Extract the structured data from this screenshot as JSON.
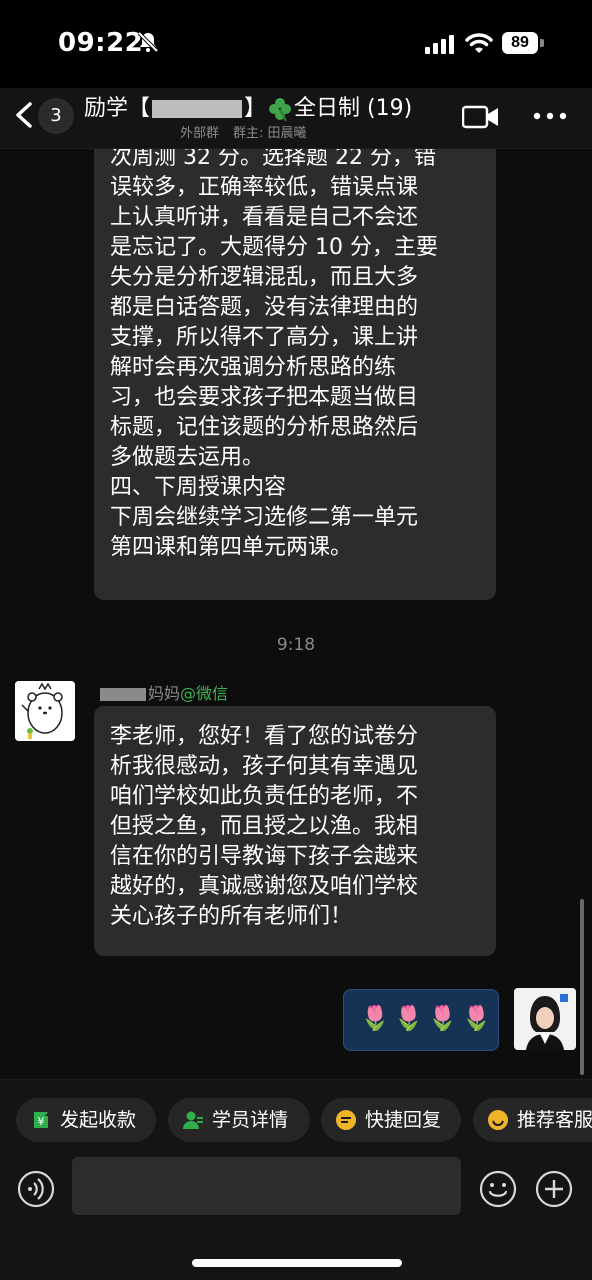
{
  "status_bar": {
    "time": "09:22",
    "battery": "89"
  },
  "header": {
    "unread_count": "3",
    "title_prefix": "励学【",
    "title_suffix": "】",
    "title_rest": "全日制",
    "member_count": "(19)",
    "tag": "外部群",
    "owner": "群主: 田晨曦"
  },
  "messages": {
    "teacher_report": "次周测 32 分。选择题 22 分，错\n误较多，正确率较低，错误点课\n上认真听讲，看看是自己不会还\n是忘记了。大题得分 10 分，主要\n失分是分析逻辑混乱，而且大多\n都是白话答题，没有法律理由的\n支撑，所以得不了高分，课上讲\n解时会再次强调分析思路的练\n习，也会要求孩子把本题当做目\n标题，记住该题的分析思路然后\n多做题去运用。\n四、下周授课内容\n下周会继续学习选修二第一单元\n第四课和第四单元两课。",
    "timestamp": "9:18",
    "sender_suffix": "妈妈",
    "sender_source": "@微信",
    "parent_reply": "李老师，您好！看了您的试卷分\n析我很感动，孩子何其有幸遇见\n咱们学校如此负责任的老师，不\n但授之鱼，而且授之以渔。我相\n信在你的引导教诲下孩子会越来\n越好的，真诚感谢您及咱们学校\n关心孩子的所有老师们！",
    "my_reply": "🌷🌷🌷🌷"
  },
  "quick_actions": [
    "发起收款",
    "学员详情",
    "快捷回复",
    "推荐客服"
  ],
  "icons": [
    "bell-slash-icon",
    "signal-icon",
    "wifi-icon",
    "back-chevron-icon",
    "video-call-icon",
    "more-icon",
    "clover-icon",
    "yuan-icon",
    "student-icon",
    "quick-reply-icon",
    "service-icon",
    "voice-icon",
    "emoji-icon",
    "plus-icon"
  ],
  "colors": {
    "wechat_green": "#3fb34f",
    "bubble_dark": "#2c2c2c",
    "sent_bubble": "#163356"
  }
}
